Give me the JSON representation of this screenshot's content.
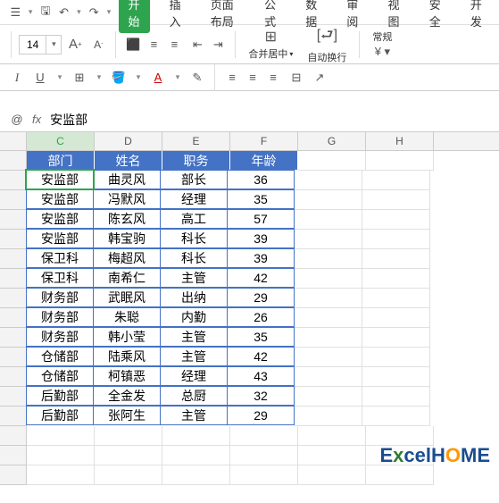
{
  "topbar": {
    "home_icon": "⌂",
    "save_icon": "💾"
  },
  "tabs": {
    "items": [
      "开始",
      "插入",
      "页面布局",
      "公式",
      "数据",
      "审阅",
      "视图",
      "安全",
      "开发"
    ],
    "active_index": 0
  },
  "ribbon": {
    "font_size": "14",
    "increase_font": "A⁺",
    "decrease_font": "A⁻",
    "merge_label": "合并居中",
    "wrap_label": "自动换行",
    "general_label": "常规"
  },
  "formula_bar": {
    "name_btn": "@",
    "fx_label": "fx",
    "value": "安监部"
  },
  "grid": {
    "columns": [
      "C",
      "D",
      "E",
      "F",
      "G",
      "H"
    ],
    "headers": [
      "部门",
      "姓名",
      "职务",
      "年龄"
    ],
    "rows": [
      {
        "dept": "安监部",
        "name": "曲灵风",
        "pos": "部长",
        "age": "36"
      },
      {
        "dept": "安监部",
        "name": "冯默风",
        "pos": "经理",
        "age": "35"
      },
      {
        "dept": "安监部",
        "name": "陈玄风",
        "pos": "高工",
        "age": "57"
      },
      {
        "dept": "安监部",
        "name": "韩宝驹",
        "pos": "科长",
        "age": "39"
      },
      {
        "dept": "保卫科",
        "name": "梅超风",
        "pos": "科长",
        "age": "39"
      },
      {
        "dept": "保卫科",
        "name": "南希仁",
        "pos": "主管",
        "age": "42"
      },
      {
        "dept": "财务部",
        "name": "武眠风",
        "pos": "出纳",
        "age": "29"
      },
      {
        "dept": "财务部",
        "name": "朱聪",
        "pos": "内勤",
        "age": "26"
      },
      {
        "dept": "财务部",
        "name": "韩小莹",
        "pos": "主管",
        "age": "35"
      },
      {
        "dept": "仓储部",
        "name": "陆乘风",
        "pos": "主管",
        "age": "42"
      },
      {
        "dept": "仓储部",
        "name": "柯镇恶",
        "pos": "经理",
        "age": "43"
      },
      {
        "dept": "后勤部",
        "name": "全金发",
        "pos": "总厨",
        "age": "32"
      },
      {
        "dept": "后勤部",
        "name": "张阿生",
        "pos": "主管",
        "age": "29"
      }
    ]
  },
  "watermark": {
    "part1": "E",
    "part2": "x",
    "part3": "cel",
    "part4": "H",
    "part5": "O",
    "part6": "ME"
  },
  "chart_data": {
    "type": "table",
    "columns": [
      "部门",
      "姓名",
      "职务",
      "年龄"
    ],
    "data": [
      [
        "安监部",
        "曲灵风",
        "部长",
        36
      ],
      [
        "安监部",
        "冯默风",
        "经理",
        35
      ],
      [
        "安监部",
        "陈玄风",
        "高工",
        57
      ],
      [
        "安监部",
        "韩宝驹",
        "科长",
        39
      ],
      [
        "保卫科",
        "梅超风",
        "科长",
        39
      ],
      [
        "保卫科",
        "南希仁",
        "主管",
        42
      ],
      [
        "财务部",
        "武眠风",
        "出纳",
        29
      ],
      [
        "财务部",
        "朱聪",
        "内勤",
        26
      ],
      [
        "财务部",
        "韩小莹",
        "主管",
        35
      ],
      [
        "仓储部",
        "陆乘风",
        "主管",
        42
      ],
      [
        "仓储部",
        "柯镇恶",
        "经理",
        43
      ],
      [
        "后勤部",
        "全金发",
        "总厨",
        32
      ],
      [
        "后勤部",
        "张阿生",
        "主管",
        29
      ]
    ]
  }
}
